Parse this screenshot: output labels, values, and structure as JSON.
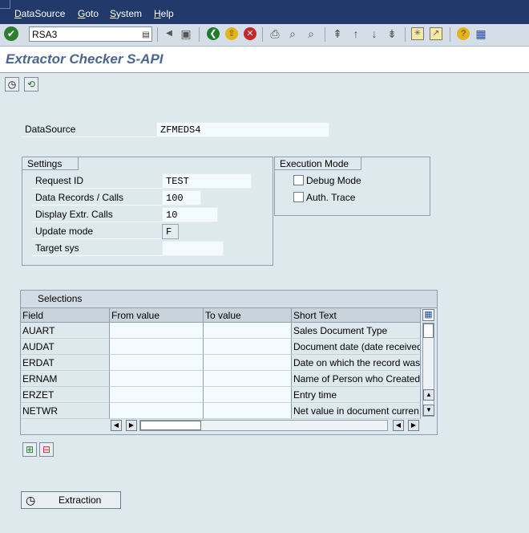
{
  "menu": {
    "items": [
      {
        "label": "DataSource",
        "underline": "D",
        "rest": "ataSource"
      },
      {
        "label": "Goto",
        "underline": "G",
        "rest": "oto"
      },
      {
        "label": "System",
        "underline": "S",
        "rest": "ystem"
      },
      {
        "label": "Help",
        "underline": "H",
        "rest": "elp"
      }
    ]
  },
  "toolbar": {
    "command_value": "RSA3"
  },
  "title": "Extractor Checker S-API",
  "datasource": {
    "label": "DataSource",
    "value": "ZFMEDS4"
  },
  "settings": {
    "tab": "Settings",
    "fields": [
      {
        "label": "Request ID",
        "value": "TEST"
      },
      {
        "label": "Data Records / Calls",
        "value": "100"
      },
      {
        "label": "Display Extr. Calls",
        "value": "10"
      },
      {
        "label": "Update mode",
        "value": "F"
      },
      {
        "label": "Target sys",
        "value": ""
      }
    ]
  },
  "execution": {
    "tab": "Execution Mode",
    "options": [
      {
        "label": "Debug Mode",
        "checked": false
      },
      {
        "label": "Auth. Trace",
        "checked": false
      }
    ]
  },
  "selections": {
    "title": "Selections",
    "columns": [
      "Field",
      "From value",
      "To value",
      "Short Text"
    ],
    "rows": [
      {
        "field": "AUART",
        "from": "",
        "to": "",
        "text": "Sales Document Type"
      },
      {
        "field": "AUDAT",
        "from": "",
        "to": "",
        "text": "Document date (date received"
      },
      {
        "field": "ERDAT",
        "from": "",
        "to": "",
        "text": "Date on which the record was"
      },
      {
        "field": "ERNAM",
        "from": "",
        "to": "",
        "text": "Name of Person who Created"
      },
      {
        "field": "ERZET",
        "from": "",
        "to": "",
        "text": "Entry time"
      },
      {
        "field": "NETWR",
        "from": "",
        "to": "",
        "text": "Net value in document curren"
      }
    ]
  },
  "extraction_button": "Extraction"
}
